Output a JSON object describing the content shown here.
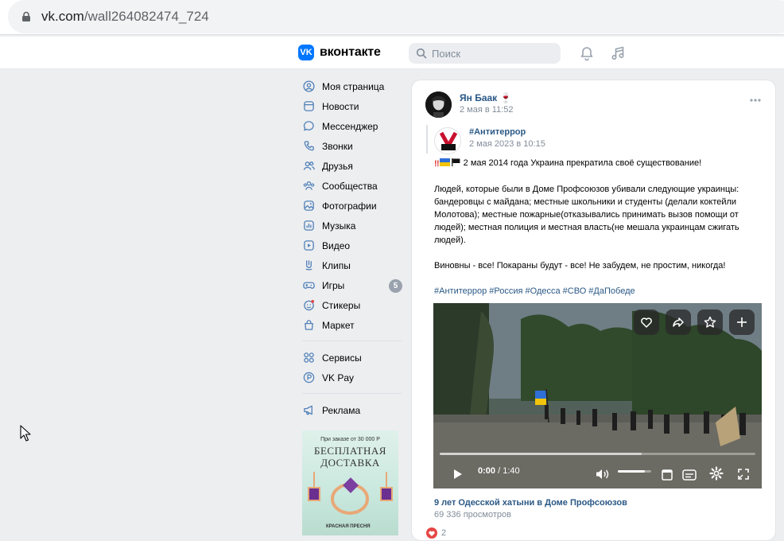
{
  "browser": {
    "url_domain": "vk.com",
    "url_path": "/wall264082474_724"
  },
  "header": {
    "logo_text": "вконтакте",
    "logo_mark": "VK",
    "search_placeholder": "Поиск",
    "icons": [
      "bell-icon",
      "music-icon"
    ]
  },
  "sidebar": {
    "items": [
      {
        "label": "Моя страница",
        "icon": "user-circle-icon"
      },
      {
        "label": "Новости",
        "icon": "news-icon"
      },
      {
        "label": "Мессенджер",
        "icon": "message-icon"
      },
      {
        "label": "Звонки",
        "icon": "phone-icon"
      },
      {
        "label": "Друзья",
        "icon": "friends-icon"
      },
      {
        "label": "Сообщества",
        "icon": "communities-icon"
      },
      {
        "label": "Фотографии",
        "icon": "photo-icon"
      },
      {
        "label": "Музыка",
        "icon": "music-icon"
      },
      {
        "label": "Видео",
        "icon": "video-icon"
      },
      {
        "label": "Клипы",
        "icon": "clips-icon"
      },
      {
        "label": "Игры",
        "icon": "game-icon",
        "badge": "5"
      },
      {
        "label": "Стикеры",
        "icon": "sticker-icon"
      },
      {
        "label": "Маркет",
        "icon": "market-icon"
      }
    ],
    "secondary": [
      {
        "label": "Сервисы",
        "icon": "services-icon"
      },
      {
        "label": "VK Pay",
        "icon": "vkpay-icon"
      }
    ],
    "tertiary": [
      {
        "label": "Реклама",
        "icon": "megaphone-icon"
      }
    ],
    "ad": {
      "line1": "При заказе от 30 000 Р",
      "line2": "БЕСПЛАТНАЯ",
      "line3": "ДОСТАВКА",
      "brand": "КРАСНАЯ ПРЕСНЯ"
    }
  },
  "post": {
    "author": "Ян Баак",
    "date": "2 мая в 11:52",
    "repost": {
      "name": "#Антитеррор",
      "date": "2 мая 2023 в 10:15"
    },
    "text_lead": "2 мая 2014 года Украина прекратила своё существование!",
    "text_p2": "Людей, которые были в Доме Профсоюзов убивали следующие украинцы: бандеровцы с майдана; местные школьники и студенты (делали коктейли Молотова); местные пожарные(отказывались принимать вызов помощи от людей); местная полиция и местная власть(не мешала украинцам сжигать людей).",
    "text_p3": "Виновны - все! Покараны будут - все! Не забудем, не простим, никогда!",
    "hashtags": "#Антитеррор #Россия #Одесса #СВО #ДаПобеде",
    "video": {
      "current_time": "0:00",
      "duration": "/ 1:40",
      "progress": 0.0,
      "buffered": 0.64,
      "volume": 0.8,
      "title": "9 лет Одесской хатыни в Доме Профсоюзов",
      "views": "69 336 просмотров"
    },
    "likes": "2"
  }
}
